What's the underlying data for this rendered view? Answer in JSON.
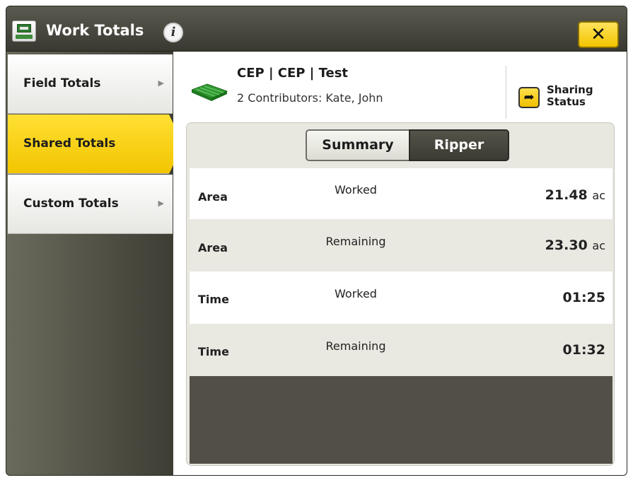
{
  "window": {
    "title": "Work Totals",
    "close_label": "✕",
    "info_label": "i"
  },
  "sidebar": {
    "items": [
      {
        "label": "Field Totals",
        "active": false
      },
      {
        "label": "Shared Totals",
        "active": true
      },
      {
        "label": "Custom Totals",
        "active": false
      }
    ]
  },
  "header": {
    "field_title": "CEP | CEP | Test",
    "contributors": "2 Contributors: Kate, John",
    "sharing_status_label": "Sharing Status"
  },
  "tabs": [
    {
      "label": "Summary",
      "selected": false
    },
    {
      "label": "Ripper",
      "selected": true
    }
  ],
  "rows": [
    {
      "name": "Area",
      "type": "Worked",
      "value": "21.48",
      "unit": "ac"
    },
    {
      "name": "Area",
      "type": "Remaining",
      "value": "23.30",
      "unit": "ac"
    },
    {
      "name": "Time",
      "type": "Worked",
      "value": "01:25",
      "unit": ""
    },
    {
      "name": "Time",
      "type": "Remaining",
      "value": "01:32",
      "unit": ""
    }
  ],
  "colors": {
    "accent_yellow": "#f2c500",
    "implement_green": "#2f9a2f",
    "panel_dark": "#3f3e36"
  },
  "icons": [
    "app-icon",
    "info-icon",
    "close-icon",
    "implement-icon",
    "share-arrow-icon",
    "chevron-right-icon"
  ]
}
